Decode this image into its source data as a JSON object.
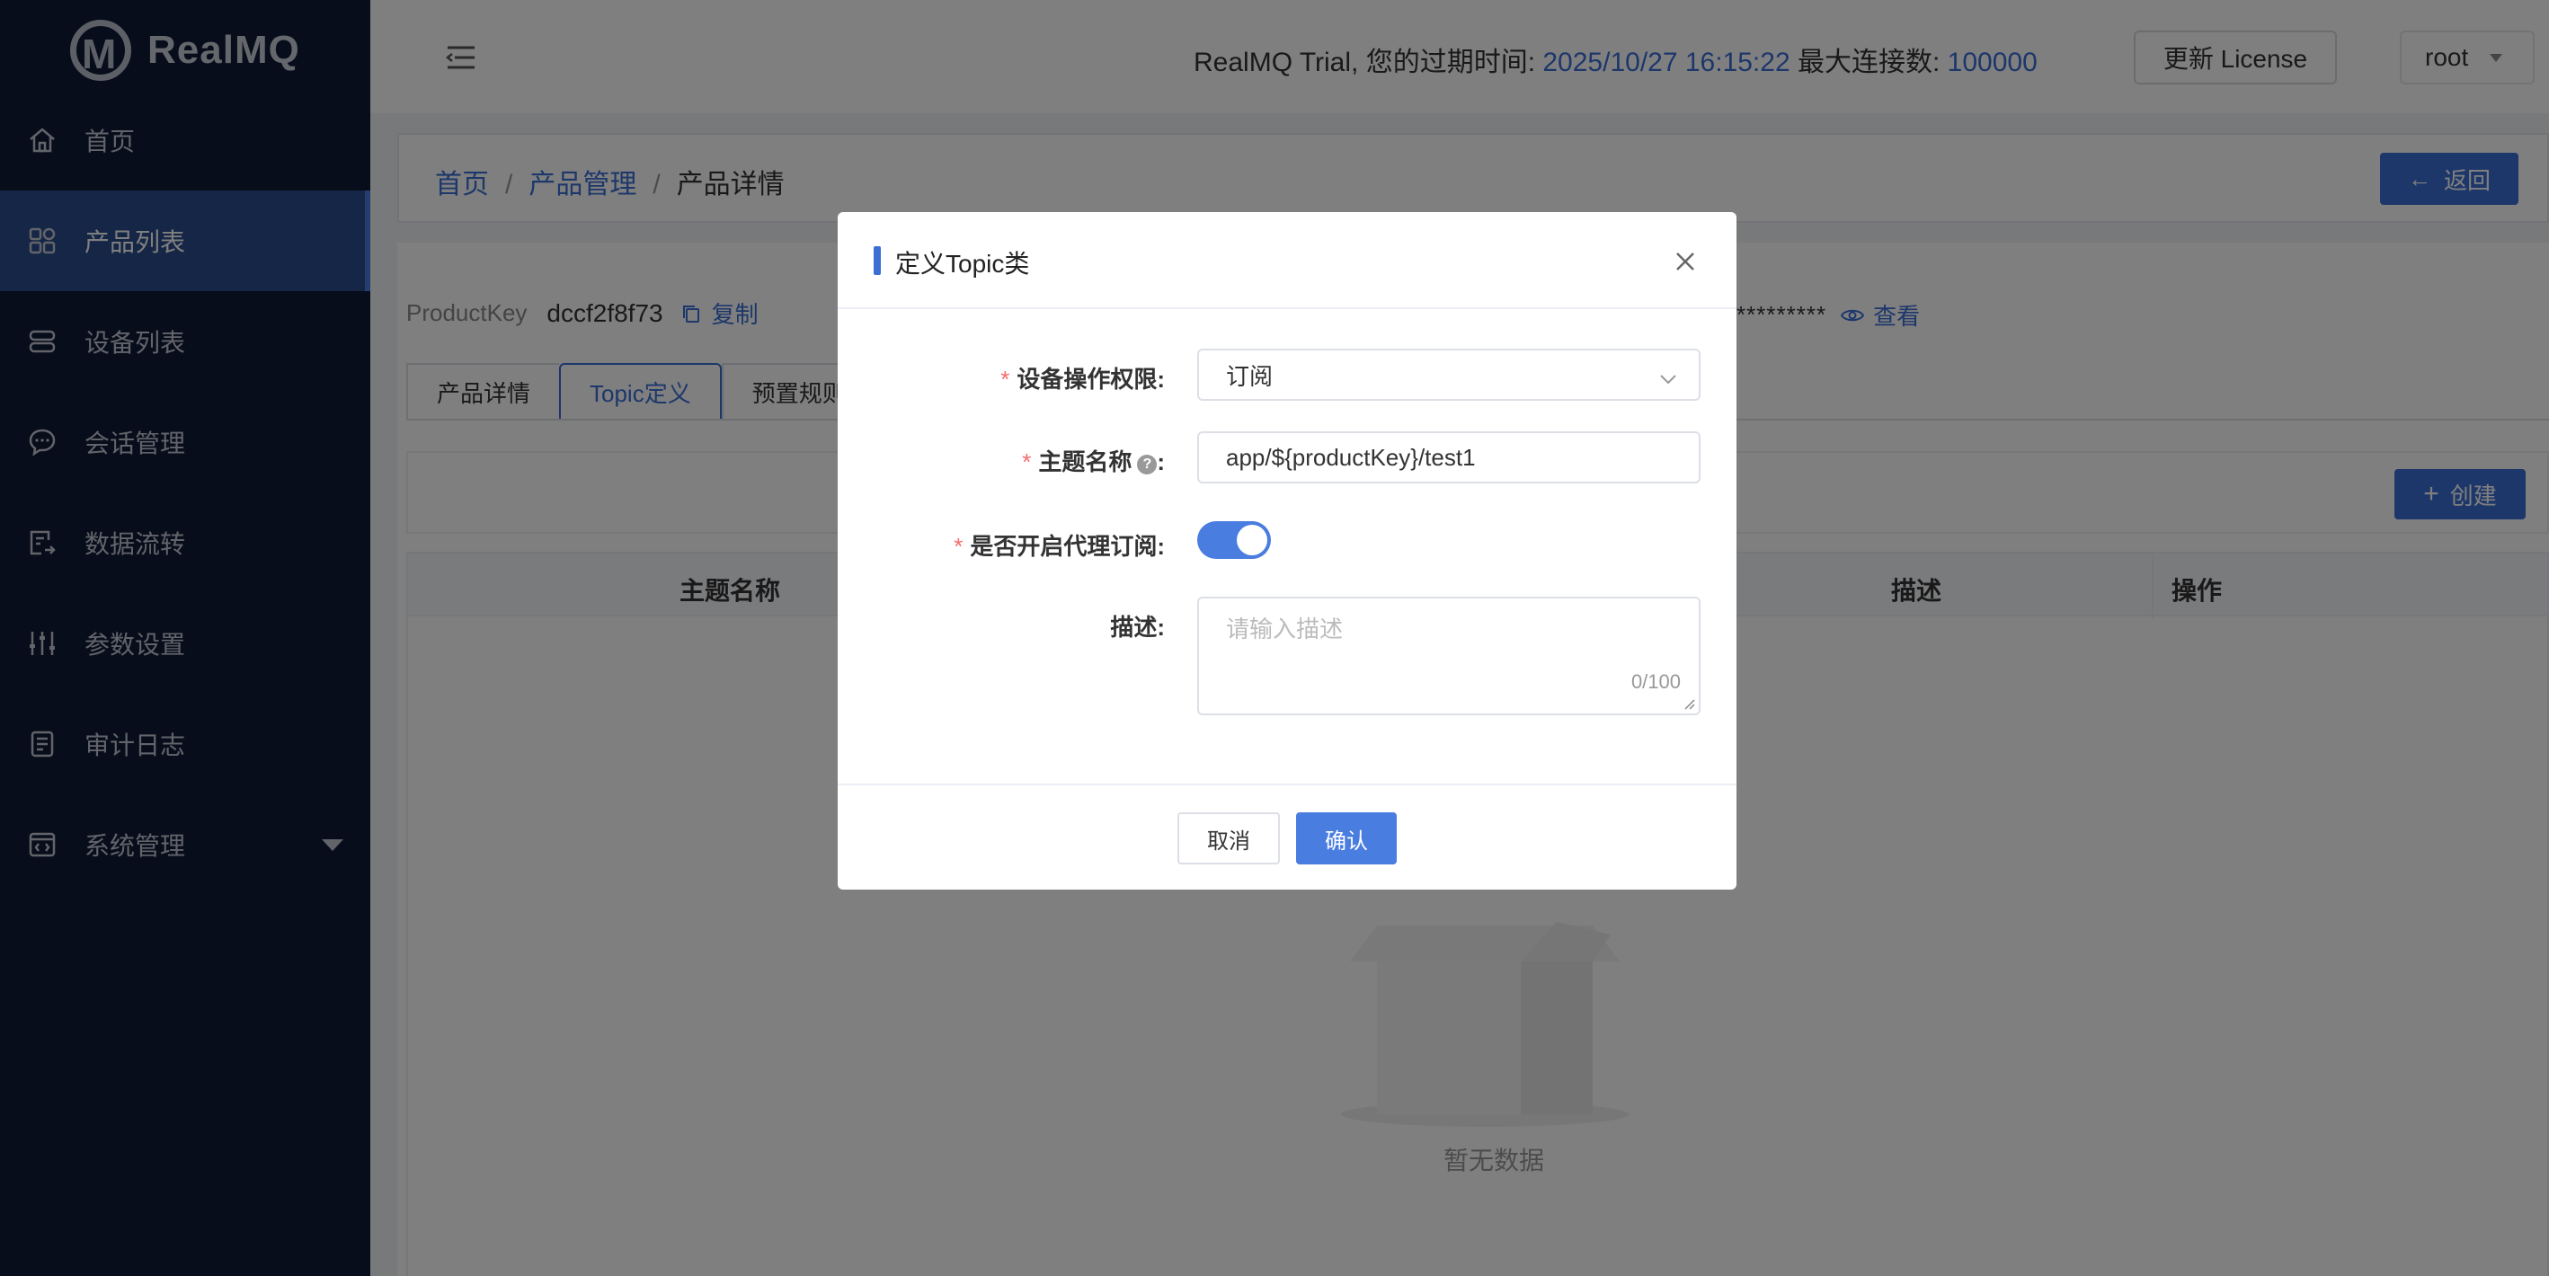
{
  "app": {
    "name": "RealMQ"
  },
  "sidebar": {
    "items": [
      {
        "label": "首页",
        "icon": "home-icon"
      },
      {
        "label": "产品列表",
        "icon": "grid-icon",
        "active": true
      },
      {
        "label": "设备列表",
        "icon": "server-icon"
      },
      {
        "label": "会话管理",
        "icon": "chat-icon"
      },
      {
        "label": "数据流转",
        "icon": "data-flow-icon"
      },
      {
        "label": "参数设置",
        "icon": "sliders-icon"
      },
      {
        "label": "审计日志",
        "icon": "log-icon"
      },
      {
        "label": "系统管理",
        "icon": "system-icon",
        "has_submenu": true
      }
    ]
  },
  "header": {
    "trial_prefix": "RealMQ Trial, 您的过期时间: ",
    "expire_time": "2025/10/27 16:15:22",
    "max_conn_label": " 最大连接数: ",
    "max_conn_value": "100000",
    "license_button": "更新 License",
    "user": "root"
  },
  "breadcrumb": {
    "items": [
      "首页",
      "产品管理",
      "产品详情"
    ],
    "separator": "/",
    "back_button": "返回"
  },
  "product": {
    "key_label": "ProductKey",
    "key_value": "dccf2f8f73",
    "copy_label": "复制",
    "secret_mask": "*********",
    "view_label": "查看"
  },
  "tabs": [
    {
      "label": "产品详情"
    },
    {
      "label": "Topic定义",
      "active": true
    },
    {
      "label": "预置规则"
    }
  ],
  "toolbar": {
    "create_button": "创建"
  },
  "table": {
    "columns": [
      "主题名称",
      "描述",
      "操作"
    ],
    "empty_text": "暂无数据"
  },
  "dialog": {
    "title": "定义Topic类",
    "fields": {
      "permission": {
        "label": "设备操作权限:",
        "value": "订阅"
      },
      "topic": {
        "label": "主题名称",
        "value": "app/${productKey}/test1"
      },
      "proxy": {
        "label": "是否开启代理订阅:",
        "enabled": true
      },
      "description": {
        "label": "描述:",
        "placeholder": "请输入描述",
        "counter": "0/100"
      }
    },
    "cancel_button": "取消",
    "confirm_button": "确认"
  },
  "colors": {
    "sidebar_bg": "#0f1a36",
    "sidebar_active": "#2b4c8c",
    "accent": "#3b6fd6",
    "required": "#f56c6c"
  }
}
